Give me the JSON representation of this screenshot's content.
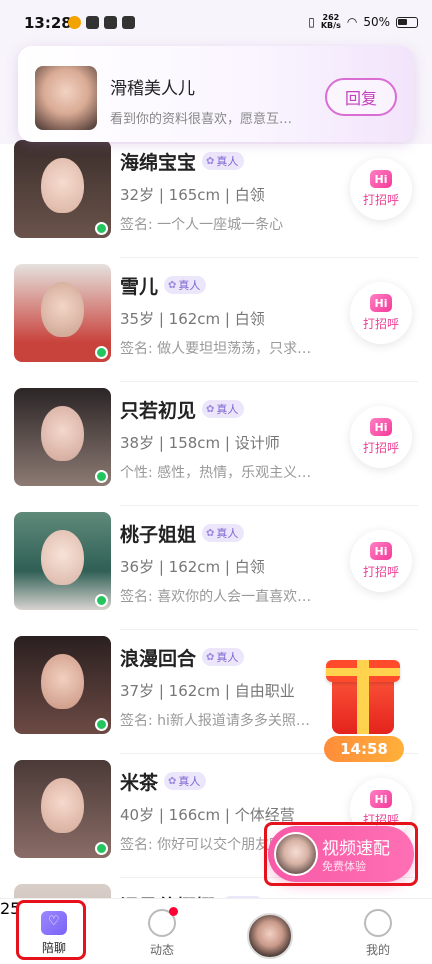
{
  "status_bar": {
    "time": "13:28",
    "net_speed_value": "262",
    "net_speed_unit": "KB/s",
    "battery": "50%"
  },
  "banner": {
    "name": "滑稽美人儿",
    "message": "看到你的资料很喜欢，愿意互…",
    "reply_label": "回复"
  },
  "hi_button": {
    "badge": "Hi",
    "label": "打招呼"
  },
  "verified_label": "真人",
  "users": [
    {
      "name": "海绵宝宝",
      "info": "32岁 | 165cm | 白领",
      "sign": "签名: 一个人一座城一条心"
    },
    {
      "name": "雪儿",
      "info": "35岁 | 162cm | 白领",
      "sign": "签名: 做人要坦坦荡荡，只求…"
    },
    {
      "name": "只若初见",
      "info": "38岁 | 158cm | 设计师",
      "sign": "个性: 感性，热情，乐观主义…"
    },
    {
      "name": "桃子姐姐",
      "info": "36岁 | 162cm | 白领",
      "sign": "签名: 喜欢你的人会一直喜欢…"
    },
    {
      "name": "浪漫回合",
      "info": "37岁 | 162cm | 自由职业",
      "sign": "签名: hi新人报道请多多关照…"
    },
    {
      "name": "米茶",
      "info": "40岁 | 166cm | 个体经营",
      "sign": "签名: 你好可以交个朋友吗"
    },
    {
      "name": "温柔的娜娜",
      "info": "",
      "sign": ""
    }
  ],
  "gift_timer": "14:58",
  "video_match": {
    "title": "视频速配",
    "subtitle": "免费体验"
  },
  "tabbar": {
    "tabs": [
      {
        "label": "陪聊"
      },
      {
        "label": "动态"
      },
      {
        "label": ""
      },
      {
        "label": "我的"
      }
    ],
    "center_count": "25"
  },
  "colors": {
    "accent_pink": "#f75aa7",
    "hi_pink": "#ee3f95",
    "verified_purple": "#7d67cf",
    "online_green": "#23c55e",
    "highlight_red": "#e5121c"
  }
}
